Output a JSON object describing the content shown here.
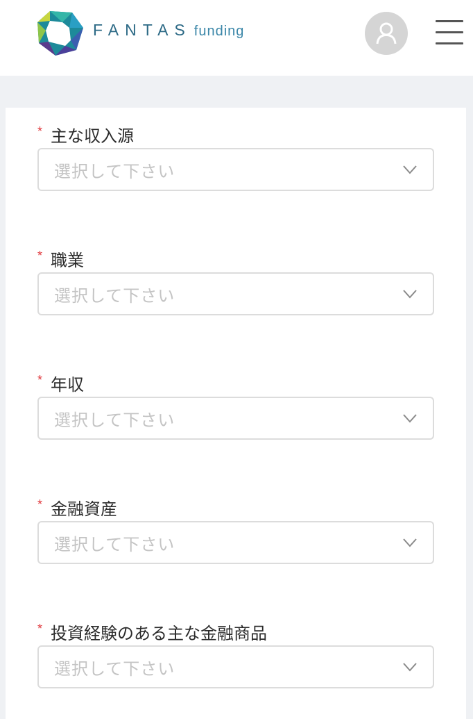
{
  "header": {
    "brand_main": "FANTAS",
    "brand_sub": "funding",
    "account_icon": "user-icon",
    "menu_icon": "hamburger-menu-icon"
  },
  "colors": {
    "required": "#e0393e",
    "brand": "#2d6a86",
    "placeholder": "#c4c4c4",
    "background": "#eff1f4"
  },
  "form": {
    "fields": [
      {
        "required_mark": "*",
        "label": "主な収入源",
        "placeholder": "選択して下さい"
      },
      {
        "required_mark": "*",
        "label": "職業",
        "placeholder": "選択して下さい"
      },
      {
        "required_mark": "*",
        "label": "年収",
        "placeholder": "選択して下さい"
      },
      {
        "required_mark": "*",
        "label": "金融資産",
        "placeholder": "選択して下さい"
      },
      {
        "required_mark": "*",
        "label": "投資経験のある主な金融商品",
        "placeholder": "選択して下さい"
      }
    ]
  }
}
